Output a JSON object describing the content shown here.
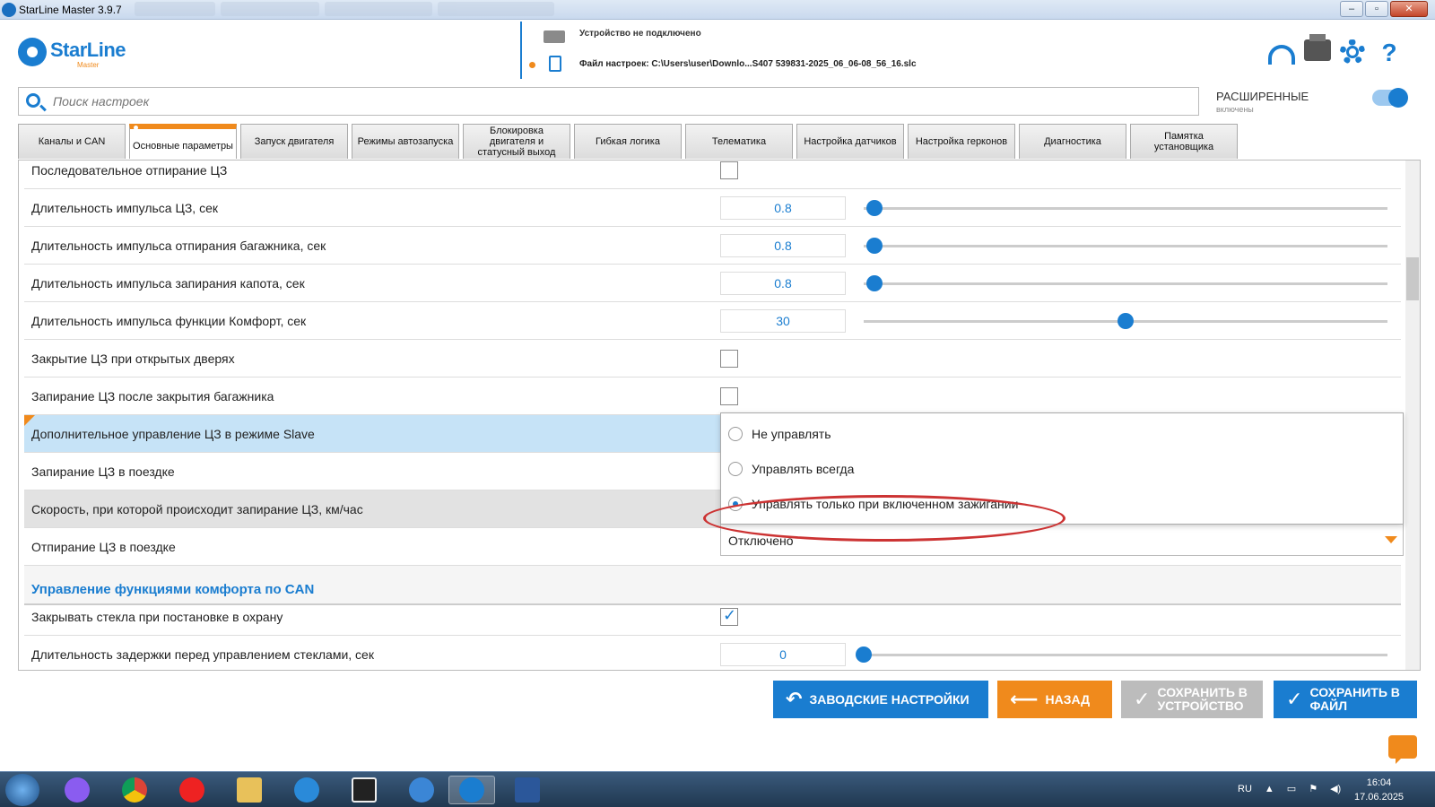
{
  "window": {
    "title": "StarLine Master 3.9.7"
  },
  "header": {
    "logo_word": "StarLine",
    "logo_sub": "Master",
    "device_status": "Устройство не подключено",
    "settings_file": "Файл настроек: C:\\Users\\user\\Downlo...S407 539831-2025_06_06-08_56_16.slc",
    "help_symbol": "?"
  },
  "search": {
    "placeholder": "Поиск настроек"
  },
  "advanced": {
    "label": "РАСШИРЕННЫЕ",
    "sub": "включены"
  },
  "tabs": [
    {
      "label": "Каналы и CAN"
    },
    {
      "label": "Основные параметры"
    },
    {
      "label": "Запуск двигателя"
    },
    {
      "label": "Режимы автозапуска"
    },
    {
      "label": "Блокировка двигателя и статусный выход"
    },
    {
      "label": "Гибкая логика"
    },
    {
      "label": "Телематика"
    },
    {
      "label": "Настройка датчиков"
    },
    {
      "label": "Настройка герконов"
    },
    {
      "label": "Диагностика"
    },
    {
      "label": "Памятка установщика"
    }
  ],
  "settings": {
    "rows": [
      {
        "label": "Последовательное отпирание ЦЗ"
      },
      {
        "label": "Длительность импульса ЦЗ, сек",
        "value": "0.8",
        "slider": 0.02
      },
      {
        "label": "Длительность импульса отпирания багажника, сек",
        "value": "0.8",
        "slider": 0.02
      },
      {
        "label": "Длительность импульса запирания капота, сек",
        "value": "0.8",
        "slider": 0.02
      },
      {
        "label": "Длительность импульса функции Комфорт, сек",
        "value": "30",
        "slider": 0.5
      },
      {
        "label": "Закрытие ЦЗ при открытых дверях"
      },
      {
        "label": "Запирание ЦЗ после закрытия багажника"
      },
      {
        "label": "Дополнительное управление ЦЗ в режиме Slave"
      },
      {
        "label": "Запирание ЦЗ в поездке"
      },
      {
        "label": "Скорость, при которой происходит запирание ЦЗ, км/час"
      },
      {
        "label": "Отпирание ЦЗ в поездке",
        "value": "Отключено"
      }
    ],
    "slave_options": [
      {
        "label": "Не управлять"
      },
      {
        "label": "Управлять всегда"
      },
      {
        "label": "Управлять только при включенном зажигании"
      }
    ],
    "section2": {
      "title": "Управление функциями комфорта по CAN",
      "rows": [
        {
          "label": "Закрывать стекла при постановке в охрану"
        },
        {
          "label": "Длительность задержки перед управлением стеклами, сек",
          "value": "0"
        }
      ]
    }
  },
  "buttons": {
    "factory": "ЗАВОДСКИЕ НАСТРОЙКИ",
    "back": "НАЗАД",
    "save_device_1": "СОХРАНИТЬ В",
    "save_device_2": "УСТРОЙСТВО",
    "save_file_1": "СОХРАНИТЬ В",
    "save_file_2": "ФАЙЛ"
  },
  "taskbar": {
    "lang": "RU",
    "time": "16:04",
    "date": "17.06.2025"
  },
  "colors": {
    "accent": "#1a7dd0",
    "orange": "#f08a1c",
    "highlight": "#c6e3f7",
    "annotation": "#cc3333"
  }
}
